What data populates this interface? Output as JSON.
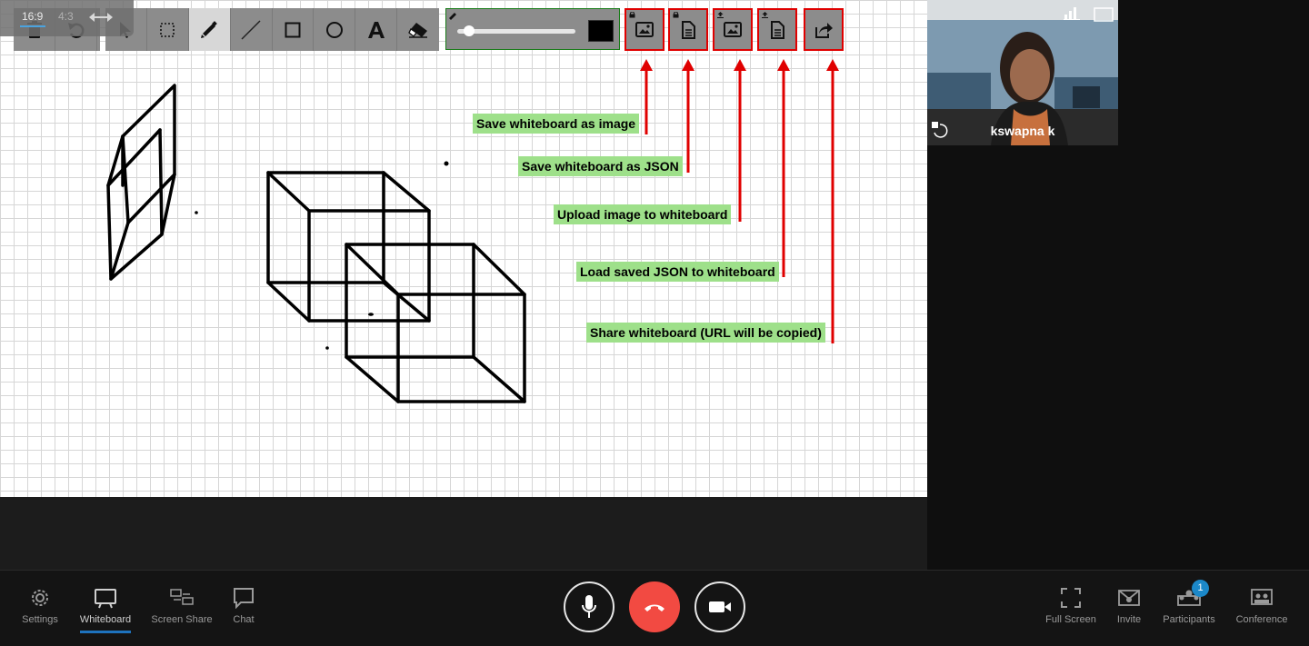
{
  "aspect_ratio": {
    "option_16_9": "16:9",
    "option_4_3": "4:3",
    "selected": "16:9"
  },
  "toolbar": {
    "tools": [
      "delete",
      "undo",
      "select",
      "region-select",
      "pencil",
      "line",
      "rectangle",
      "circle",
      "text",
      "eraser"
    ],
    "active_tool": "pencil",
    "stroke_color": "#000000",
    "brush_size_level": 0.1
  },
  "annotations": {
    "save_image": "Save whiteboard as image",
    "save_json": "Save whiteboard as JSON",
    "upload_image": "Upload image to whiteboard",
    "load_json": "Load saved JSON to whiteboard",
    "share": "Share whiteboard (URL will be copied)"
  },
  "participant": {
    "name": "kswapna k"
  },
  "bottom_bar": {
    "settings": "Settings",
    "whiteboard": "Whiteboard",
    "screen_share": "Screen Share",
    "chat": "Chat",
    "full_screen": "Full Screen",
    "invite": "Invite",
    "participants": "Participants",
    "participants_count": "1",
    "conference": "Conference"
  },
  "colors": {
    "annotation_bg": "#9ee08a",
    "highlight": "#e00000",
    "hangup": "#f24a42",
    "accent": "#1e73be"
  }
}
